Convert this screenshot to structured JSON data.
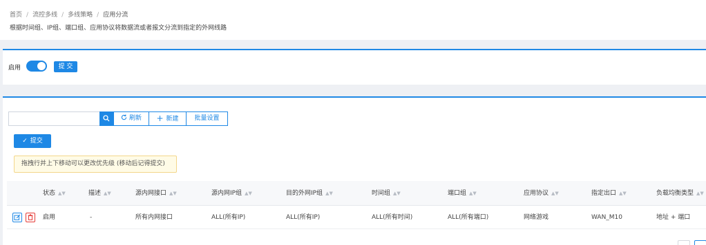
{
  "breadcrumb": {
    "items": [
      "首页",
      "流控多线",
      "多线策略",
      "应用分流"
    ],
    "separator": "/"
  },
  "description": "根据时间组、IP组、端口组、应用协议将数据流或者报文分流到指定的外网线路",
  "settings": {
    "enable_label": "启用",
    "enabled": true,
    "submit_label": "提 交"
  },
  "toolbar": {
    "search_placeholder": "",
    "refresh_label": "刷新",
    "new_label": "新建",
    "batch_label": "批量设置",
    "submit_label": "提交"
  },
  "notice": "拖拽行并上下移动可以更改优先级 (移动后记得提交)",
  "table": {
    "columns": [
      "状态",
      "描述",
      "源内网接口",
      "源内网IP组",
      "目的外网IP组",
      "时间组",
      "端口组",
      "应用协议",
      "指定出口",
      "负载均衡类型"
    ],
    "rows": [
      {
        "status": "启用",
        "description": "-",
        "src_interface": "所有内网接口",
        "src_ip_group": "ALL(所有IP)",
        "dst_ip_group": "ALL(所有IP)",
        "time_group": "ALL(所有时间)",
        "port_group": "ALL(所有端口)",
        "app_protocol": "网络游戏",
        "outlet": "WAN_M10",
        "lb_type": "地址 + 端口"
      }
    ]
  },
  "icons": {
    "search": "search-icon",
    "refresh": "refresh-icon",
    "add": "plus-icon",
    "check": "check-icon",
    "edit": "edit-icon",
    "delete": "trash-icon",
    "sort": "sort-icon"
  },
  "colors": {
    "primary": "#1e88e5",
    "danger": "#e53935",
    "notice_bg": "#fffbe6",
    "notice_border": "#f3d68a"
  }
}
